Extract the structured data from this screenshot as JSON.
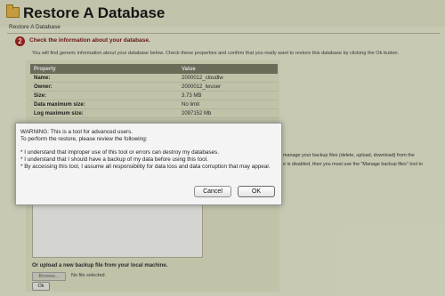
{
  "header": {
    "title": "Restore A Database",
    "breadcrumb": "Restore A Database"
  },
  "step": {
    "number": "2",
    "heading": "Check the information about your database.",
    "info": "You will find generic information about your database below. Check these properties and confirm that you really want to restore this database by clicking the Ok button."
  },
  "properties": {
    "col_property": "Property",
    "col_value": "Value",
    "rows": [
      {
        "key": "Name:",
        "value": "2000012_cloudlw"
      },
      {
        "key": "Owner:",
        "value": "2000012_lwuser"
      },
      {
        "key": "Size:",
        "value": "3.73 MB"
      },
      {
        "key": "Data maximum size:",
        "value": "No limit"
      },
      {
        "key": "Log maximum size:",
        "value": "2097152 Mb"
      }
    ]
  },
  "side_text": {
    "line1": "manage your backup files (delete, upload, download) from the",
    "line2": "e is disabled, then you must use the \"Manage backup files\" tool to"
  },
  "upload": {
    "label": "Or upload a new backup file from your local machine.",
    "browse": "Browse...",
    "file_status": "No file selected.",
    "ok": "Ok"
  },
  "dialog": {
    "warning": "WARNING: This is a tool for advanced users.",
    "instruction": "To perform the restore, please review the following:",
    "bullet1": "* I understand that improper use of this tool or errors can destroy my databases.",
    "bullet2": "* I understand that I should have a backup of my data before using this tool.",
    "bullet3": "* By accessing this tool, I assume all responsibility for data loss and data corruption that may appear.",
    "cancel": "Cancel",
    "ok": "OK"
  },
  "colors": {
    "step_circle": "#a5231c",
    "table_header": "#7d7e68",
    "page_background": "#ecedd3"
  }
}
